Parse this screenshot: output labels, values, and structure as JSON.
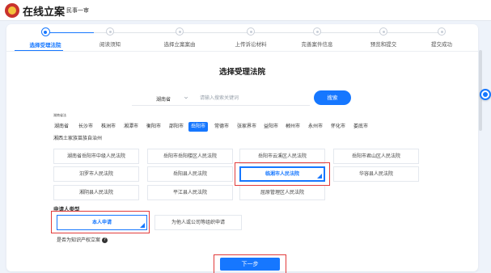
{
  "header": {
    "app_title": "在线立案",
    "case_type": "民事一审"
  },
  "steps": [
    {
      "label": "选择受理法院",
      "active": true
    },
    {
      "label": "阅读须知",
      "active": false
    },
    {
      "label": "选择立案案由",
      "active": false
    },
    {
      "label": "上传诉讼材料",
      "active": false
    },
    {
      "label": "完善案件信息",
      "active": false
    },
    {
      "label": "预览和提交",
      "active": false
    },
    {
      "label": "提交成功",
      "active": false
    }
  ],
  "page_heading": "选择受理法院",
  "search": {
    "province": "湖南省",
    "placeholder": "请输入搜索关键词",
    "button_label": "搜索"
  },
  "tiny_note": "湖南省法",
  "cities": [
    "湖南省",
    "长沙市",
    "株洲市",
    "湘潭市",
    "衡阳市",
    "邵阳市",
    "岳阳市",
    "常德市",
    "张家界市",
    "益阳市",
    "郴州市",
    "永州市",
    "怀化市",
    "娄底市"
  ],
  "active_city": "岳阳市",
  "autonomous_prefecture": "湘西土家族苗族自治州",
  "courts": [
    {
      "name": "湖南省岳阳市中级人民法院",
      "selected": false
    },
    {
      "name": "岳阳市岳阳楼区人民法院",
      "selected": false
    },
    {
      "name": "岳阳市云溪区人民法院",
      "selected": false
    },
    {
      "name": "岳阳市君山区人民法院",
      "selected": false
    },
    {
      "name": "汨罗市人民法院",
      "selected": false
    },
    {
      "name": "岳阳县人民法院",
      "selected": false
    },
    {
      "name": "临湘市人民法院",
      "selected": true
    },
    {
      "name": "华容县人民法院",
      "selected": false
    },
    {
      "name": "湘阴县人民法院",
      "selected": false
    },
    {
      "name": "平江县人民法院",
      "selected": false
    },
    {
      "name": "屈原管理区人民法院",
      "selected": false
    }
  ],
  "applicant": {
    "section_title": "申请人类型",
    "self_label": "本人申请",
    "other_label": "为他人或公司等组织申请",
    "ip_label": "是否为知识产权立案"
  },
  "next_button": "下一步",
  "colors": {
    "primary": "#1677ff",
    "highlight_box": "#e23b3b",
    "logo_red": "#c9322d"
  }
}
